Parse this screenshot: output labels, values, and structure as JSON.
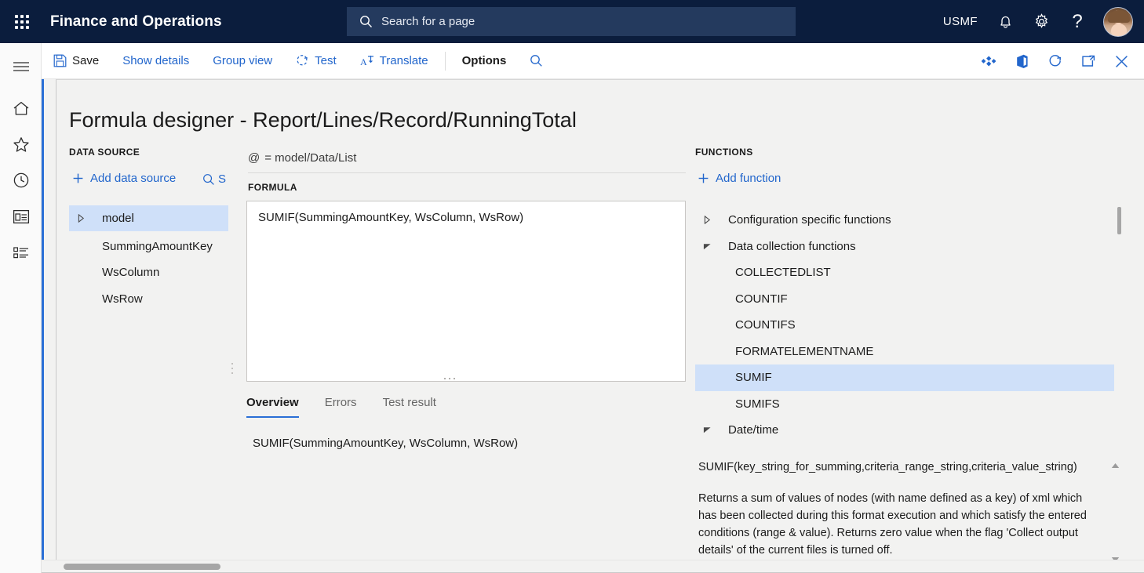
{
  "topbar": {
    "waffle_label": "app-launcher",
    "app_title": "Finance and Operations",
    "search_placeholder": "Search for a page",
    "company": "USMF",
    "help_glyph": "?"
  },
  "rail": {
    "items": [
      {
        "icon": "hamburger-menu-icon",
        "name": "navigation-menu"
      },
      {
        "icon": "home-icon",
        "name": "home"
      },
      {
        "icon": "star-icon",
        "name": "favorites"
      },
      {
        "icon": "clock-icon",
        "name": "recent"
      },
      {
        "icon": "workspace-icon",
        "name": "workspaces"
      },
      {
        "icon": "list-icon",
        "name": "modules"
      }
    ]
  },
  "commandbar": {
    "save_label": "Save",
    "show_details_label": "Show details",
    "group_view_label": "Group view",
    "test_label": "Test",
    "translate_label": "Translate",
    "options_label": "Options",
    "right_icons": [
      "power-apps-icon",
      "office-icon",
      "refresh-icon",
      "open-in-new-window-icon",
      "close-icon"
    ]
  },
  "page": {
    "title": "Formula designer - Report/Lines/Record/RunningTotal",
    "accent_color": "#2a6fd6"
  },
  "data_source": {
    "heading": "DATA SOURCE",
    "add_label": "Add data source",
    "search_label": "S",
    "tree": [
      {
        "label": "model",
        "has_caret": true,
        "selected": true,
        "indent": false
      },
      {
        "label": "SummingAmountKey",
        "has_caret": false,
        "selected": false,
        "indent": true
      },
      {
        "label": "WsColumn",
        "has_caret": false,
        "selected": false,
        "indent": true
      },
      {
        "label": "WsRow",
        "has_caret": false,
        "selected": false,
        "indent": true
      }
    ]
  },
  "formula": {
    "binding_symbol": "@",
    "binding_value": "= model/Data/List",
    "heading": "FORMULA",
    "text": "SUMIF(SummingAmountKey, WsColumn, WsRow)",
    "tabs": [
      {
        "label": "Overview",
        "active": true
      },
      {
        "label": "Errors",
        "active": false
      },
      {
        "label": "Test result",
        "active": false
      }
    ],
    "overview_text": "SUMIF(SummingAmountKey, WsColumn, WsRow)"
  },
  "functions": {
    "heading": "FUNCTIONS",
    "add_label": "Add function",
    "tree": [
      {
        "label": "Configuration specific functions",
        "caret": "collapsed",
        "selected": false,
        "leaf": false
      },
      {
        "label": "Data collection functions",
        "caret": "expanded",
        "selected": false,
        "leaf": false
      },
      {
        "label": "COLLECTEDLIST",
        "caret": "none",
        "selected": false,
        "leaf": true
      },
      {
        "label": "COUNTIF",
        "caret": "none",
        "selected": false,
        "leaf": true
      },
      {
        "label": "COUNTIFS",
        "caret": "none",
        "selected": false,
        "leaf": true
      },
      {
        "label": "FORMATELEMENTNAME",
        "caret": "none",
        "selected": false,
        "leaf": true
      },
      {
        "label": "SUMIF",
        "caret": "none",
        "selected": true,
        "leaf": true
      },
      {
        "label": "SUMIFS",
        "caret": "none",
        "selected": false,
        "leaf": true
      },
      {
        "label": "Date/time",
        "caret": "expanded",
        "selected": false,
        "leaf": false
      }
    ],
    "selected_highlight_color": "#cfe0f9"
  },
  "description": {
    "signature": "SUMIF(key_string_for_summing,criteria_range_string,criteria_value_string)",
    "body": "Returns a sum of values of nodes (with name defined as a key) of xml which has been collected during this format execution and which satisfy the entered conditions (range & value). Returns zero value when the flag 'Collect output details' of the current files is turned off."
  }
}
